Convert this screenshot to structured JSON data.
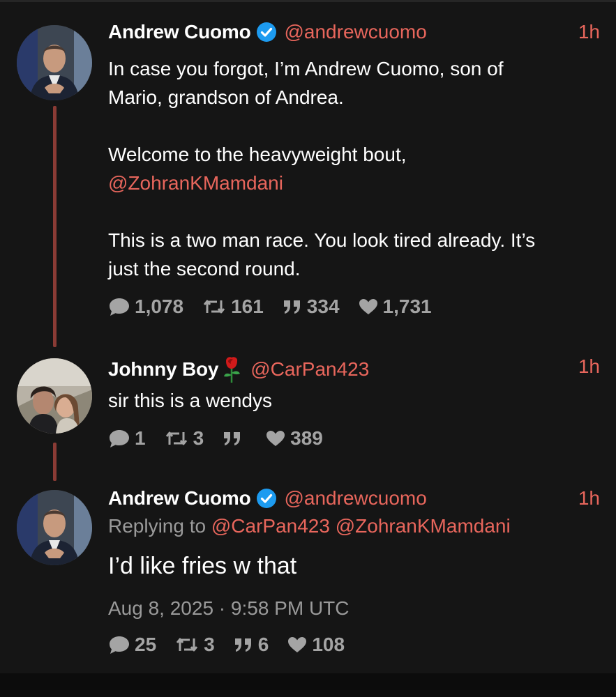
{
  "tweets": [
    {
      "author_name": "Andrew Cuomo",
      "verified": true,
      "handle": "@andrewcuomo",
      "time": "1h",
      "body": [
        {
          "text": "In case you forgot, I’m Andrew Cuomo, son of"
        },
        {
          "text": "Mario, grandson of Andrea."
        },
        {
          "text": ""
        },
        {
          "text": "Welcome to the heavyweight bout,"
        },
        {
          "text": "@ZohranKMamdani",
          "mention": true
        },
        {
          "text": ""
        },
        {
          "text": "This is a two man race. You look tired already. It’s"
        },
        {
          "text": "just the second round."
        }
      ],
      "stats": {
        "replies": "1,078",
        "retweets": "161",
        "quotes": "334",
        "likes": "1,731"
      }
    },
    {
      "author_name": "Johnny Boy",
      "emoji": "rose-icon",
      "handle": "@CarPan423",
      "time": "1h",
      "body_text": "sir this is a wendys",
      "stats": {
        "replies": "1",
        "retweets": "3",
        "quotes": "",
        "likes": "389"
      }
    },
    {
      "author_name": "Andrew Cuomo",
      "verified": true,
      "handle": "@andrewcuomo",
      "time": "1h",
      "replying_to_label": "Replying to",
      "replying_to_handles": "@CarPan423 @ZohranKMamdani",
      "body_text": "I’d like fries w that",
      "timestamp": "Aug 8, 2025 · 9:58 PM UTC",
      "stats": {
        "replies": "25",
        "retweets": "3",
        "quotes": "6",
        "likes": "108"
      }
    }
  ],
  "colors": {
    "background": "#151515",
    "accent": "#e8665c",
    "thread_line": "#8a3b35",
    "muted": "#a4a4a4",
    "verified_badge": "#1d9bf0"
  }
}
